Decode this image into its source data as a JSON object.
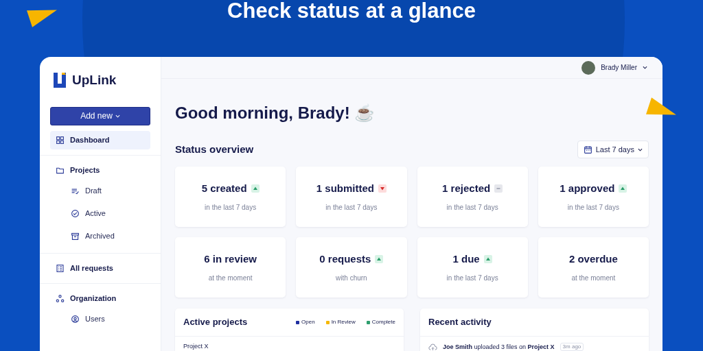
{
  "headline": "Check status at a glance",
  "brand": "UpLink",
  "add_button": "Add new",
  "sidebar": {
    "groups": [
      {
        "items": [
          {
            "label": "Dashboard",
            "kind": "grid",
            "selected": true
          }
        ]
      },
      {
        "items": [
          {
            "label": "Projects",
            "kind": "folder",
            "selected": false,
            "children": [
              {
                "label": "Draft",
                "kind": "lines",
                "selected": false
              },
              {
                "label": "Active",
                "kind": "check",
                "selected": false
              },
              {
                "label": "Archived",
                "kind": "archive",
                "selected": false
              }
            ]
          }
        ]
      },
      {
        "items": [
          {
            "label": "All requests",
            "kind": "list",
            "selected": false
          }
        ]
      },
      {
        "items": [
          {
            "label": "Organization",
            "kind": "dots",
            "selected": false,
            "children": [
              {
                "label": "Users",
                "kind": "user",
                "selected": false
              }
            ]
          }
        ]
      }
    ]
  },
  "user": {
    "name": "Brady Miller"
  },
  "greeting": "Good morning, Brady! ☕",
  "status_overview": {
    "title": "Status overview",
    "range": "Last 7 days",
    "stats": [
      {
        "value": "5 created",
        "caption": "in the last 7 days",
        "kind": "up"
      },
      {
        "value": "1 submitted",
        "caption": "in the last 7 days",
        "kind": "down"
      },
      {
        "value": "1 rejected",
        "caption": "in the last 7 days",
        "kind": "flat"
      },
      {
        "value": "1 approved",
        "caption": "in the last 7 days",
        "kind": "up"
      },
      {
        "value": "6 in review",
        "caption": "at the moment",
        "kind": "none"
      },
      {
        "value": "0 requests",
        "caption": "with churn",
        "kind": "up"
      },
      {
        "value": "1 due",
        "caption": "in the last 7 days",
        "kind": "up"
      },
      {
        "value": "2 overdue",
        "caption": "at the moment",
        "kind": "none"
      }
    ]
  },
  "active_projects": {
    "title": "Active projects",
    "legend": [
      {
        "label": "Open",
        "color": "#1f2fa0"
      },
      {
        "label": "In Review",
        "color": "#f5b800"
      },
      {
        "label": "Complete",
        "color": "#2e9e6e"
      }
    ],
    "rows": [
      "Project X"
    ]
  },
  "recent_activity": {
    "title": "Recent activity",
    "items": [
      {
        "text": "**Joe Smith** uploaded 3 files on **Project X**",
        "time": "3m ago"
      }
    ]
  }
}
